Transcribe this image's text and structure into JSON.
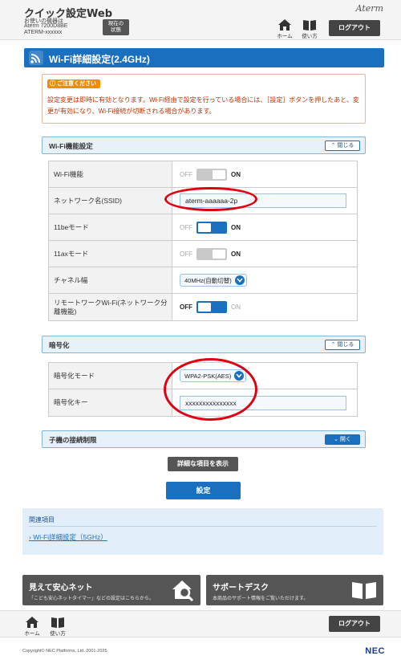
{
  "header": {
    "app_title": "クイック設定Web",
    "device_label": "お使いの機器は",
    "device_model": "Aterm 7200D8BE",
    "device_name": "ATERM-xxxxxx",
    "status_button_line1": "現在の",
    "status_button_line2": "状態",
    "brand": "Aterm",
    "home_label": "ホーム",
    "help_label": "使い方",
    "logout_label": "ログアウト"
  },
  "page": {
    "title": "Wi-Fi詳細設定(2.4GHz)"
  },
  "notice": {
    "badge": "ご注意ください",
    "text": "設定変更は即時に有効となります。Wi-Fi経由で設定を行っている場合には、［設定］ボタンを押したあと、変更が有効になり、Wi-Fi接続が切断される場合があります。"
  },
  "wifi_section": {
    "title": "Wi-Fi機能設定",
    "toggle_label": "閉じる",
    "rows": [
      {
        "label": "Wi-Fi機能",
        "type": "switch",
        "state": "off",
        "off_label": "OFF",
        "on_label": "ON"
      },
      {
        "label": "ネットワーク名(SSID)",
        "type": "text",
        "value": "aterm-aaaaaa-2p"
      },
      {
        "label": "11beモード",
        "type": "switch",
        "state": "on",
        "off_label": "OFF",
        "on_label": "ON"
      },
      {
        "label": "11axモード",
        "type": "switch",
        "state": "off",
        "off_label": "OFF",
        "on_label": "ON"
      },
      {
        "label": "チャネル幅",
        "type": "select",
        "value": "40MHz(自動切替)"
      },
      {
        "label": "リモートワークWi-Fi(ネットワーク分離機能)",
        "type": "switch",
        "state": "off",
        "off_label": "OFF",
        "on_label": "ON"
      }
    ]
  },
  "encryption_section": {
    "title": "暗号化",
    "toggle_label": "閉じる",
    "rows": [
      {
        "label": "暗号化モード",
        "type": "select",
        "value": "WPA2-PSK(AES)"
      },
      {
        "label": "暗号化キー",
        "type": "text",
        "value": "xxxxxxxxxxxxxxx"
      }
    ]
  },
  "child_section": {
    "title": "子機の接続制限",
    "toggle_label": "開く"
  },
  "buttons": {
    "show_details": "詳細な項目を表示",
    "apply": "設定"
  },
  "related": {
    "title": "関連項目",
    "link": "Wi-Fi詳細設定（5GHz）"
  },
  "promo": [
    {
      "title": "見えて安心ネット",
      "subtitle": "「こども安心ネットタイマー」などの設定はこちらから。"
    },
    {
      "title": "サポートデスク",
      "subtitle": "本商品のサポート情報をご覧いただけます。"
    }
  ],
  "footer": {
    "home_label": "ホーム",
    "help_label": "使い方",
    "logout_label": "ログアウト",
    "copyright": "Copyright© NEC Platforms, Ltd. 2001-2025",
    "maker": "NEC"
  },
  "colors": {
    "accent": "#1a6fbf",
    "highlight": "#e00010",
    "notice_text": "#c03000",
    "badge": "#f08c00"
  }
}
